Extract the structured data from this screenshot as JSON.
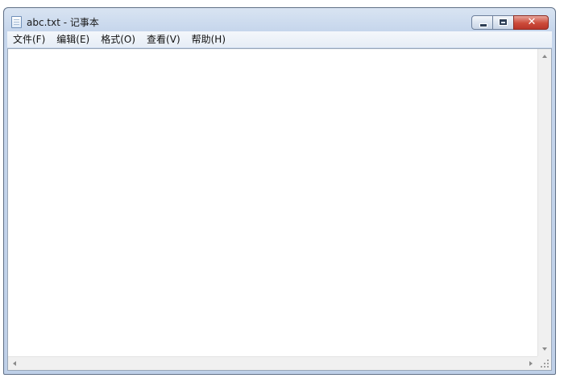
{
  "window": {
    "title": "abc.txt - 记事本"
  },
  "menu": {
    "items": [
      "文件(F)",
      "编辑(E)",
      "格式(O)",
      "查看(V)",
      "帮助(H)"
    ]
  },
  "editor": {
    "content": ""
  },
  "icons": {
    "app": "notepad-document-icon",
    "minimize": "minimize-icon",
    "maximize": "maximize-icon",
    "close": "close-icon",
    "scroll_up": "arrow-up-icon",
    "scroll_down": "arrow-down-icon",
    "scroll_left": "arrow-left-icon",
    "scroll_right": "arrow-right-icon",
    "grip": "resize-grip-icon"
  },
  "colors": {
    "frame": "#c6d6ec",
    "close_button": "#cc4b3a",
    "text_area": "#ffffff"
  }
}
